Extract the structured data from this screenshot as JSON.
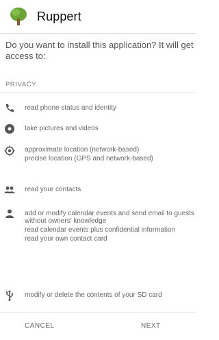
{
  "app": {
    "name": "Ruppert",
    "icon": "tree-icon",
    "icon_color": "#6aa535"
  },
  "prompt": {
    "question": "Do you want to install this application? It will get access to:"
  },
  "section": {
    "label": "PRIVACY"
  },
  "permissions": [
    {
      "icon": "phone-icon",
      "lines": [
        "read phone status and identity"
      ]
    },
    {
      "icon": "camera-icon",
      "lines": [
        "take pictures and videos"
      ]
    },
    {
      "icon": "location-icon",
      "lines": [
        "approximate location (network-based)",
        "precise location (GPS and network-based)"
      ]
    },
    {
      "icon": "contacts-icon",
      "lines": [
        "read your contacts"
      ]
    },
    {
      "icon": "person-icon",
      "lines": [
        "add or modify calendar events and send email to guests without owners' knowledge",
        "read calendar events plus confidential information",
        "read your own contact card"
      ]
    },
    {
      "icon": "usb-icon",
      "lines": [
        "modify or delete the contents of your SD card"
      ]
    }
  ],
  "footer": {
    "cancel_label": "CANCEL",
    "next_label": "NEXT"
  },
  "colors": {
    "text": "#666666",
    "icon": "#555555",
    "divider": "#d6d6d6"
  }
}
